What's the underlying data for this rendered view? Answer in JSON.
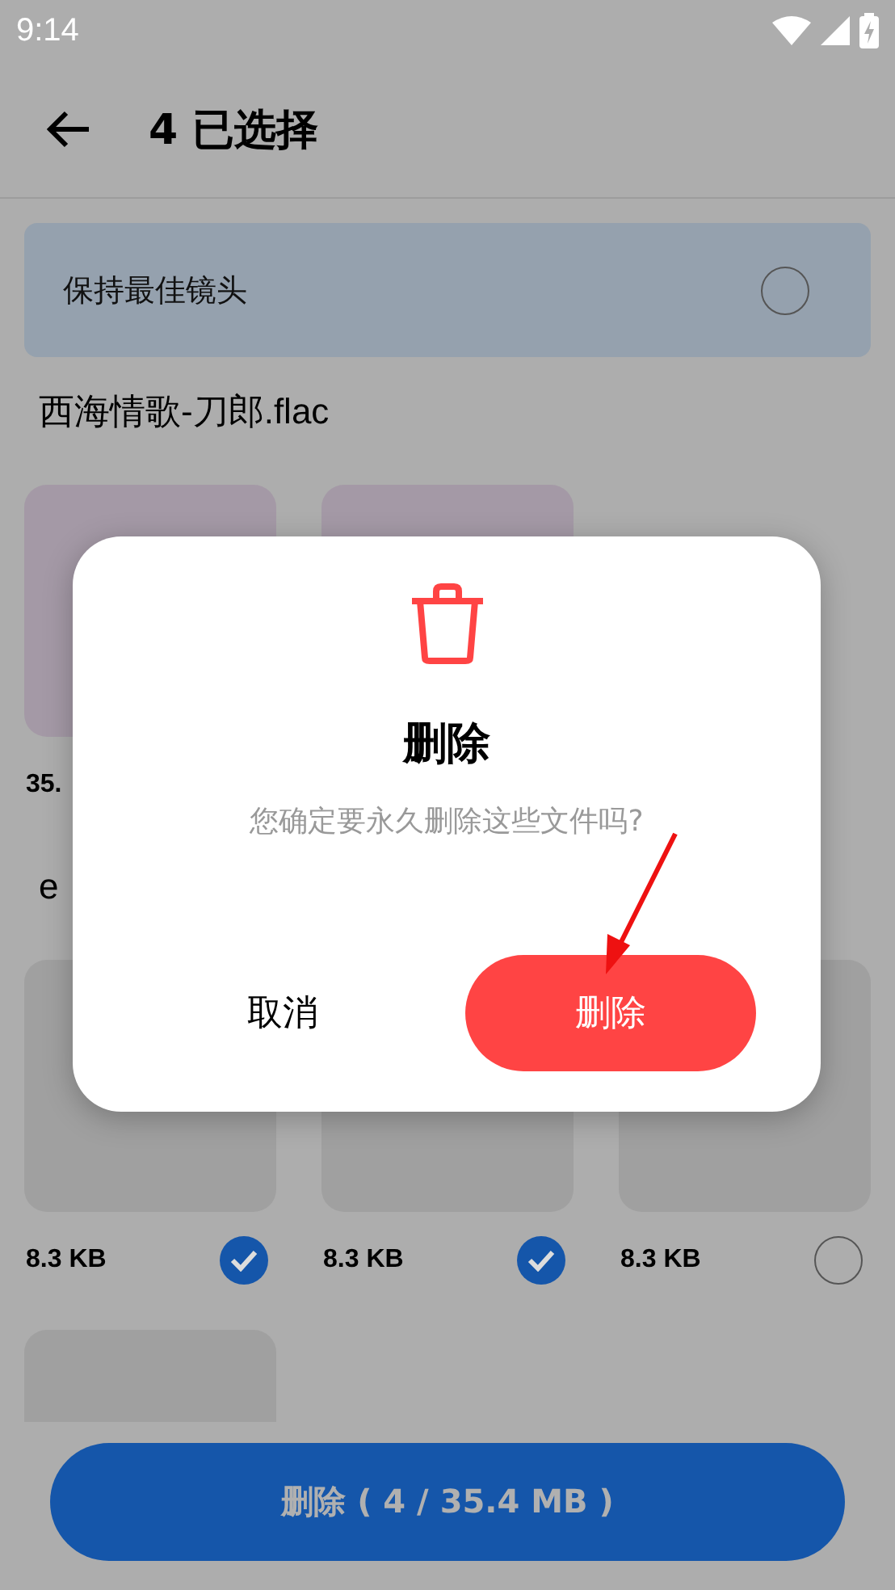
{
  "status_bar": {
    "time": "9:14"
  },
  "app_bar": {
    "title": "4 已选择"
  },
  "keep_best": {
    "label": "保持最佳镜头",
    "checked": false
  },
  "groups": [
    {
      "name": "西海情歌-刀郎.flac",
      "files": [
        {
          "kind": "audio",
          "size": "35."
        },
        {
          "kind": "audio"
        }
      ]
    },
    {
      "name": "e",
      "files": [
        {
          "kind": "image",
          "size": "8.3 KB",
          "checked": true
        },
        {
          "kind": "image",
          "size": "8.3 KB",
          "checked": true
        },
        {
          "kind": "image",
          "size": "8.3 KB",
          "checked": false
        },
        {
          "kind": "image"
        }
      ]
    }
  ],
  "dialog": {
    "title": "删除",
    "message": "您确定要永久删除这些文件吗?",
    "cancel": "取消",
    "confirm": "删除"
  },
  "delete_button": {
    "label": "删除 ( 4 / 35.4 MB )"
  }
}
